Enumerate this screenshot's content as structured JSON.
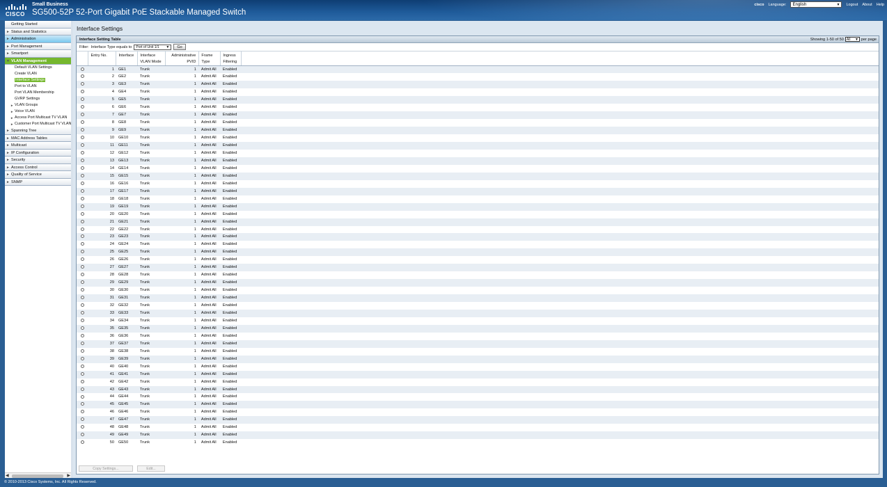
{
  "header": {
    "brand": "Small Business",
    "title": "SG500-52P 52-Port Gigabit PoE Stackable Managed Switch",
    "logo_text": "CISCO",
    "top_logo": "cisco",
    "language_label": "Language:",
    "language_value": "English",
    "logout": "Logout",
    "about": "About",
    "help": "Help"
  },
  "sidebar": {
    "items": [
      {
        "label": "Getting Started",
        "kind": "item",
        "arrow": ""
      },
      {
        "label": "Status and Statistics",
        "kind": "item",
        "arrow": "►"
      },
      {
        "label": "Administration",
        "kind": "item",
        "arrow": "►"
      },
      {
        "label": "Port Management",
        "kind": "item",
        "arrow": "►"
      },
      {
        "label": "Smartport",
        "kind": "item",
        "arrow": "►"
      },
      {
        "label": "VLAN Management",
        "kind": "item",
        "arrow": "▼"
      },
      {
        "label": "Default VLAN Settings",
        "kind": "sub",
        "arrow": ""
      },
      {
        "label": "Create VLAN",
        "kind": "sub",
        "arrow": ""
      },
      {
        "label": "Interface Settings",
        "kind": "sub",
        "arrow": ""
      },
      {
        "label": "Port to VLAN",
        "kind": "sub",
        "arrow": ""
      },
      {
        "label": "Port VLAN Membership",
        "kind": "sub",
        "arrow": ""
      },
      {
        "label": "GVRP Settings",
        "kind": "sub",
        "arrow": ""
      },
      {
        "label": "VLAN Groups",
        "kind": "sub",
        "arrow": "►"
      },
      {
        "label": "Voice VLAN",
        "kind": "sub",
        "arrow": "►"
      },
      {
        "label": "Access Port Multicast TV VLAN",
        "kind": "sub",
        "arrow": "►"
      },
      {
        "label": "Customer Port Multicast TV VLAN",
        "kind": "sub",
        "arrow": "►"
      },
      {
        "label": "Spanning Tree",
        "kind": "item",
        "arrow": "►"
      },
      {
        "label": "MAC Address Tables",
        "kind": "item",
        "arrow": "►"
      },
      {
        "label": "Multicast",
        "kind": "item",
        "arrow": "►"
      },
      {
        "label": "IP Configuration",
        "kind": "item",
        "arrow": "►"
      },
      {
        "label": "Security",
        "kind": "item",
        "arrow": "►"
      },
      {
        "label": "Access Control",
        "kind": "item",
        "arrow": "►"
      },
      {
        "label": "Quality of Service",
        "kind": "item",
        "arrow": "►"
      },
      {
        "label": "SNMP",
        "kind": "item",
        "arrow": "►"
      }
    ]
  },
  "main": {
    "page_title": "Interface Settings",
    "table_title": "Interface Setting Table",
    "showing": "Showing 1-50 of 50",
    "per_page_value": "All",
    "per_page_label": "per page",
    "filter_label": "Filter:",
    "filter_text": "Interface Type equals to",
    "filter_value": "Port of Unit 1/1",
    "go_label": "Go",
    "columns": [
      {
        "line1": "",
        "line2": ""
      },
      {
        "line1": "Entry No.",
        "line2": ""
      },
      {
        "line1": "Interface",
        "line2": ""
      },
      {
        "line1": "Interface",
        "line2": "VLAN Mode"
      },
      {
        "line1": "Administrative",
        "line2": "PVID"
      },
      {
        "line1": "Frame",
        "line2": "Type"
      },
      {
        "line1": "Ingress",
        "line2": "Filtering"
      }
    ],
    "rows": [
      [
        "1",
        "GE1",
        "Trunk",
        "1",
        "Admit All",
        "Enabled"
      ],
      [
        "2",
        "GE2",
        "Trunk",
        "1",
        "Admit All",
        "Enabled"
      ],
      [
        "3",
        "GE3",
        "Trunk",
        "1",
        "Admit All",
        "Enabled"
      ],
      [
        "4",
        "GE4",
        "Trunk",
        "1",
        "Admit All",
        "Enabled"
      ],
      [
        "5",
        "GE5",
        "Trunk",
        "1",
        "Admit All",
        "Enabled"
      ],
      [
        "6",
        "GE6",
        "Trunk",
        "1",
        "Admit All",
        "Enabled"
      ],
      [
        "7",
        "GE7",
        "Trunk",
        "1",
        "Admit All",
        "Enabled"
      ],
      [
        "8",
        "GE8",
        "Trunk",
        "1",
        "Admit All",
        "Enabled"
      ],
      [
        "9",
        "GE9",
        "Trunk",
        "1",
        "Admit All",
        "Enabled"
      ],
      [
        "10",
        "GE10",
        "Trunk",
        "1",
        "Admit All",
        "Enabled"
      ],
      [
        "11",
        "GE11",
        "Trunk",
        "1",
        "Admit All",
        "Enabled"
      ],
      [
        "12",
        "GE12",
        "Trunk",
        "1",
        "Admit All",
        "Enabled"
      ],
      [
        "13",
        "GE13",
        "Trunk",
        "1",
        "Admit All",
        "Enabled"
      ],
      [
        "14",
        "GE14",
        "Trunk",
        "1",
        "Admit All",
        "Enabled"
      ],
      [
        "15",
        "GE15",
        "Trunk",
        "1",
        "Admit All",
        "Enabled"
      ],
      [
        "16",
        "GE16",
        "Trunk",
        "1",
        "Admit All",
        "Enabled"
      ],
      [
        "17",
        "GE17",
        "Trunk",
        "1",
        "Admit All",
        "Enabled"
      ],
      [
        "18",
        "GE18",
        "Trunk",
        "1",
        "Admit All",
        "Enabled"
      ],
      [
        "19",
        "GE19",
        "Trunk",
        "1",
        "Admit All",
        "Enabled"
      ],
      [
        "20",
        "GE20",
        "Trunk",
        "1",
        "Admit All",
        "Enabled"
      ],
      [
        "21",
        "GE21",
        "Trunk",
        "1",
        "Admit All",
        "Enabled"
      ],
      [
        "22",
        "GE22",
        "Trunk",
        "1",
        "Admit All",
        "Enabled"
      ],
      [
        "23",
        "GE23",
        "Trunk",
        "1",
        "Admit All",
        "Enabled"
      ],
      [
        "24",
        "GE24",
        "Trunk",
        "1",
        "Admit All",
        "Enabled"
      ],
      [
        "25",
        "GE25",
        "Trunk",
        "1",
        "Admit All",
        "Enabled"
      ],
      [
        "26",
        "GE26",
        "Trunk",
        "1",
        "Admit All",
        "Enabled"
      ],
      [
        "27",
        "GE27",
        "Trunk",
        "1",
        "Admit All",
        "Enabled"
      ],
      [
        "28",
        "GE28",
        "Trunk",
        "1",
        "Admit All",
        "Enabled"
      ],
      [
        "29",
        "GE29",
        "Trunk",
        "1",
        "Admit All",
        "Enabled"
      ],
      [
        "30",
        "GE30",
        "Trunk",
        "1",
        "Admit All",
        "Enabled"
      ],
      [
        "31",
        "GE31",
        "Trunk",
        "1",
        "Admit All",
        "Enabled"
      ],
      [
        "32",
        "GE32",
        "Trunk",
        "1",
        "Admit All",
        "Enabled"
      ],
      [
        "33",
        "GE33",
        "Trunk",
        "1",
        "Admit All",
        "Enabled"
      ],
      [
        "34",
        "GE34",
        "Trunk",
        "1",
        "Admit All",
        "Enabled"
      ],
      [
        "35",
        "GE35",
        "Trunk",
        "1",
        "Admit All",
        "Enabled"
      ],
      [
        "36",
        "GE36",
        "Trunk",
        "1",
        "Admit All",
        "Enabled"
      ],
      [
        "37",
        "GE37",
        "Trunk",
        "1",
        "Admit All",
        "Enabled"
      ],
      [
        "38",
        "GE38",
        "Trunk",
        "1",
        "Admit All",
        "Enabled"
      ],
      [
        "39",
        "GE39",
        "Trunk",
        "1",
        "Admit All",
        "Enabled"
      ],
      [
        "40",
        "GE40",
        "Trunk",
        "1",
        "Admit All",
        "Enabled"
      ],
      [
        "41",
        "GE41",
        "Trunk",
        "1",
        "Admit All",
        "Enabled"
      ],
      [
        "42",
        "GE42",
        "Trunk",
        "1",
        "Admit All",
        "Enabled"
      ],
      [
        "43",
        "GE43",
        "Trunk",
        "1",
        "Admit All",
        "Enabled"
      ],
      [
        "44",
        "GE44",
        "Trunk",
        "1",
        "Admit All",
        "Enabled"
      ],
      [
        "45",
        "GE45",
        "Trunk",
        "1",
        "Admit All",
        "Enabled"
      ],
      [
        "46",
        "GE46",
        "Trunk",
        "1",
        "Admit All",
        "Enabled"
      ],
      [
        "47",
        "GE47",
        "Trunk",
        "1",
        "Admit All",
        "Enabled"
      ],
      [
        "48",
        "GE48",
        "Trunk",
        "1",
        "Admit All",
        "Enabled"
      ],
      [
        "49",
        "GE49",
        "Trunk",
        "1",
        "Admit All",
        "Enabled"
      ],
      [
        "50",
        "GE50",
        "Trunk",
        "1",
        "Admit All",
        "Enabled"
      ]
    ],
    "copy_label": "Copy Settings...",
    "edit_label": "Edit..."
  },
  "footer": {
    "copyright": "© 2010-2013 Cisco Systems, Inc. All Rights Reserved."
  },
  "colors": {
    "accent_green": "#75b72e",
    "header_blue": "#1f5b9a"
  }
}
